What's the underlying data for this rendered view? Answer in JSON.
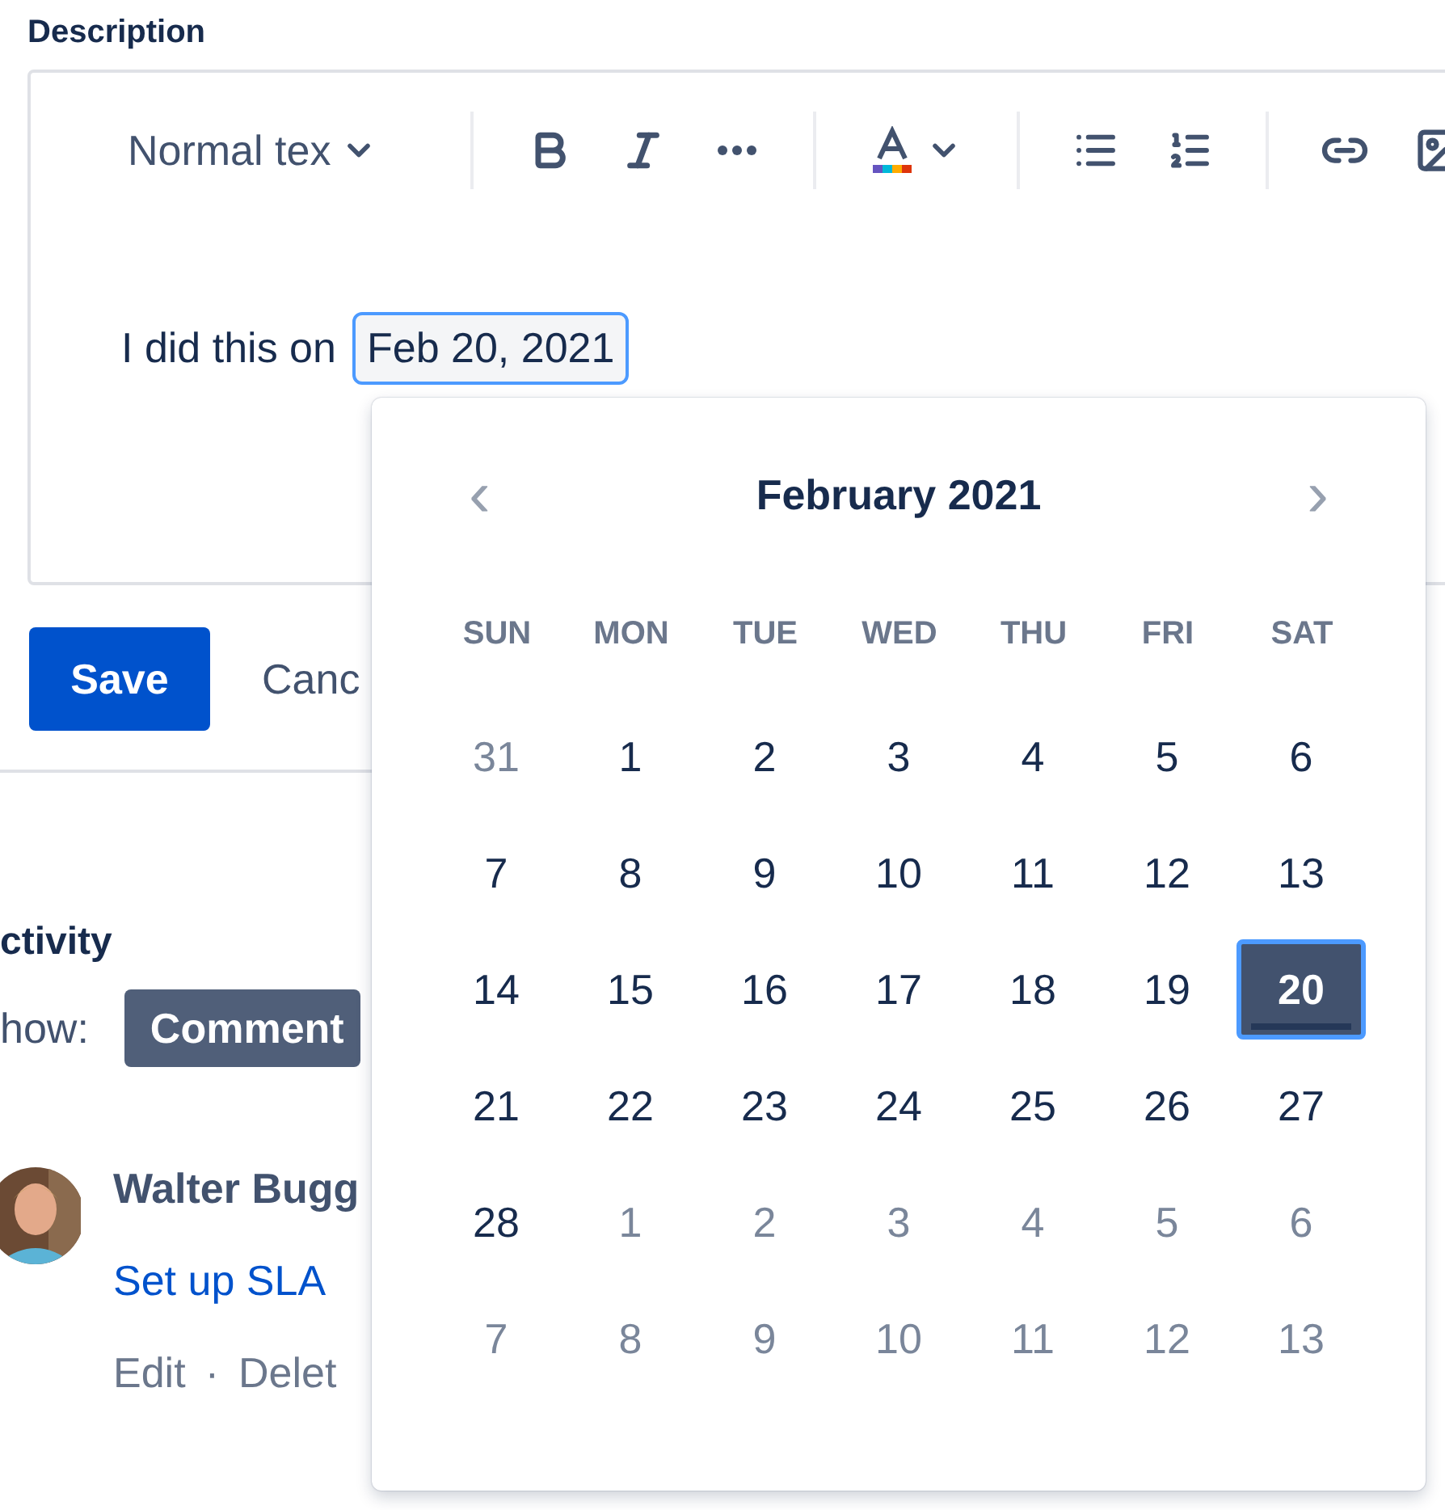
{
  "description": {
    "label": "Description",
    "style_menu": "Normal tex",
    "body_text": "I did this on",
    "date_chip": "Feb 20, 2021"
  },
  "actions": {
    "save": "Save",
    "cancel": "Canc"
  },
  "activity": {
    "heading": "ctivity",
    "show_label": "how:",
    "filter": "Comment"
  },
  "comment": {
    "author": "Walter Bugg",
    "link": "Set up SLA",
    "edit": "Edit",
    "separator": "·",
    "delete": "Delet"
  },
  "date_picker": {
    "prev": "‹",
    "next": "›",
    "month": "February 2021",
    "weekdays": [
      "SUN",
      "MON",
      "TUE",
      "WED",
      "THU",
      "FRI",
      "SAT"
    ],
    "weeks": [
      [
        {
          "label": "31",
          "outside": true,
          "selected": false,
          "today": false
        },
        {
          "label": "1",
          "outside": false,
          "selected": false,
          "today": false
        },
        {
          "label": "2",
          "outside": false,
          "selected": false,
          "today": false
        },
        {
          "label": "3",
          "outside": false,
          "selected": false,
          "today": false
        },
        {
          "label": "4",
          "outside": false,
          "selected": false,
          "today": false
        },
        {
          "label": "5",
          "outside": false,
          "selected": false,
          "today": false
        },
        {
          "label": "6",
          "outside": false,
          "selected": false,
          "today": false
        }
      ],
      [
        {
          "label": "7",
          "outside": false,
          "selected": false,
          "today": false
        },
        {
          "label": "8",
          "outside": false,
          "selected": false,
          "today": false
        },
        {
          "label": "9",
          "outside": false,
          "selected": false,
          "today": false
        },
        {
          "label": "10",
          "outside": false,
          "selected": false,
          "today": false
        },
        {
          "label": "11",
          "outside": false,
          "selected": false,
          "today": false
        },
        {
          "label": "12",
          "outside": false,
          "selected": false,
          "today": false
        },
        {
          "label": "13",
          "outside": false,
          "selected": false,
          "today": false
        }
      ],
      [
        {
          "label": "14",
          "outside": false,
          "selected": false,
          "today": false
        },
        {
          "label": "15",
          "outside": false,
          "selected": false,
          "today": false
        },
        {
          "label": "16",
          "outside": false,
          "selected": false,
          "today": false
        },
        {
          "label": "17",
          "outside": false,
          "selected": false,
          "today": false
        },
        {
          "label": "18",
          "outside": false,
          "selected": false,
          "today": false
        },
        {
          "label": "19",
          "outside": false,
          "selected": false,
          "today": false
        },
        {
          "label": "20",
          "outside": false,
          "selected": true,
          "today": true
        }
      ],
      [
        {
          "label": "21",
          "outside": false,
          "selected": false,
          "today": false
        },
        {
          "label": "22",
          "outside": false,
          "selected": false,
          "today": false
        },
        {
          "label": "23",
          "outside": false,
          "selected": false,
          "today": false
        },
        {
          "label": "24",
          "outside": false,
          "selected": false,
          "today": false
        },
        {
          "label": "25",
          "outside": false,
          "selected": false,
          "today": false
        },
        {
          "label": "26",
          "outside": false,
          "selected": false,
          "today": false
        },
        {
          "label": "27",
          "outside": false,
          "selected": false,
          "today": false
        }
      ],
      [
        {
          "label": "28",
          "outside": false,
          "selected": false,
          "today": false
        },
        {
          "label": "1",
          "outside": true,
          "selected": false,
          "today": false
        },
        {
          "label": "2",
          "outside": true,
          "selected": false,
          "today": false
        },
        {
          "label": "3",
          "outside": true,
          "selected": false,
          "today": false
        },
        {
          "label": "4",
          "outside": true,
          "selected": false,
          "today": false
        },
        {
          "label": "5",
          "outside": true,
          "selected": false,
          "today": false
        },
        {
          "label": "6",
          "outside": true,
          "selected": false,
          "today": false
        }
      ],
      [
        {
          "label": "7",
          "outside": true,
          "selected": false,
          "today": false
        },
        {
          "label": "8",
          "outside": true,
          "selected": false,
          "today": false
        },
        {
          "label": "9",
          "outside": true,
          "selected": false,
          "today": false
        },
        {
          "label": "10",
          "outside": true,
          "selected": false,
          "today": false
        },
        {
          "label": "11",
          "outside": true,
          "selected": false,
          "today": false
        },
        {
          "label": "12",
          "outside": true,
          "selected": false,
          "today": false
        },
        {
          "label": "13",
          "outside": true,
          "selected": false,
          "today": false
        }
      ]
    ]
  }
}
